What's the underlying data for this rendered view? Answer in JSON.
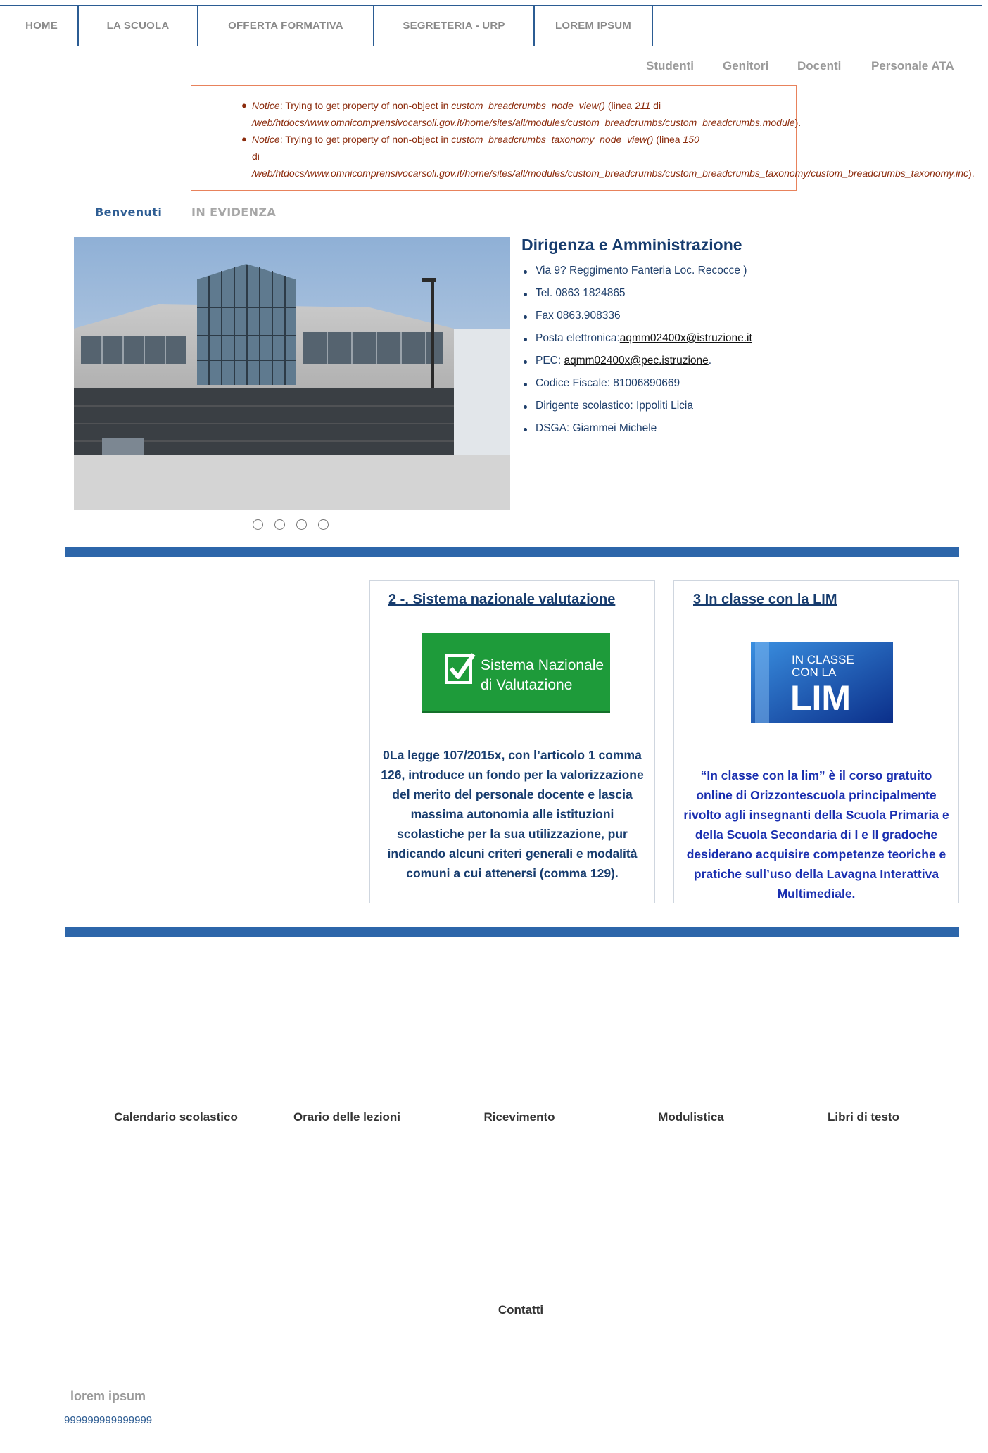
{
  "nav": {
    "items": [
      "HOME",
      "LA SCUOLA",
      "OFFERTA FORMATIVA",
      "SEGRETERIA - URP",
      "LOREM IPSUM"
    ]
  },
  "user_links": [
    "Studenti",
    "Genitori",
    "Docenti",
    "Personale ATA"
  ],
  "notices": [
    {
      "label": "Notice",
      "message": ": Trying to get property of non-object in ",
      "function": "custom_breadcrumbs_node_view()",
      "line_prefix": " (linea ",
      "line": "211",
      "line_suffix": " di",
      "path": "/web/htdocs/www.omnicomprensivocarsoli.gov.it/home/sites/all/modules/custom_breadcrumbs/custom_breadcrumbs.module",
      "end": ")."
    },
    {
      "label": "Notice",
      "message": ": Trying to get property of non-object in ",
      "function": "custom_breadcrumbs_taxonomy_node_view()",
      "line_prefix": " (linea ",
      "line": "150",
      "line_suffix": "",
      "di": "di",
      "path": "/web/htdocs/www.omnicomprensivocarsoli.gov.it/home/sites/all/modules/custom_breadcrumbs/custom_breadcrumbs_taxonomy/custom_breadcrumbs_taxonomy.inc",
      "end": ")."
    }
  ],
  "tabs": {
    "active": "Benvenuti",
    "other": "IN EVIDENZA"
  },
  "info": {
    "title": "Dirigenza e Amministrazione",
    "address": "Via 9? Reggimento Fanteria  Loc. Recocce )",
    "tel": "Tel. 0863 1824865",
    "fax": "Fax 0863.908336",
    "email_label": "Posta elettronica:",
    "email": "aqmm02400x@istruzione.it",
    "pec_label": "PEC: ",
    "pec": "aqmm02400x@pec.istruzione",
    "pec_end": ".",
    "cf": "Codice Fiscale: 81006890669",
    "dirigente": "Dirigente scolastico: Ippoliti Licia",
    "dsga": "DSGA: Giammei Michele"
  },
  "cards": [
    {
      "title": "2 -. Sistema nazionale valutazione",
      "banner_line1": "Sistema Nazionale",
      "banner_line2": "di Valutazione",
      "text": "0La legge 107/2015x, con l’articolo 1 comma 126, introduce un fondo per la valorizzazione del merito del personale docente e lascia massima autonomia alle istituzioni scolastiche per la sua utilizzazione, pur indicando alcuni criteri generali e modalità comuni a cui attenersi (comma 129).",
      "text_color": "#173c6e",
      "banner_color": "#1e9b3a"
    },
    {
      "title": "3 In classe con la LIM",
      "banner_line1": "IN CLASSE",
      "banner_line2": "CON LA",
      "banner_line3": "LIM",
      "text": "“In classe con la lim” è il corso gratuito online di Orizzontescuola principalmente rivolto agli insegnanti della Scuola Primaria e della Scuola Secondaria di I e II gradoche desiderano acquisire competenze teoriche e pratiche sull’uso della Lavagna Interattiva Multimediale.",
      "text_color": "#1a2fb0",
      "banner_color": "#1f56b8"
    }
  ],
  "quick_links": [
    "Calendario scolastico",
    "Orario delle lezioni",
    "Ricevimento",
    "Modulistica",
    "Libri di testo"
  ],
  "contatti": "Contatti",
  "footer": {
    "title": "lorem ipsum",
    "number": "999999999999999"
  },
  "colors": {
    "brand_blue": "#2d66aa",
    "nav_rule": "#2b5c93",
    "notice_border": "#e8825c",
    "notice_text": "#8b2b0c"
  }
}
